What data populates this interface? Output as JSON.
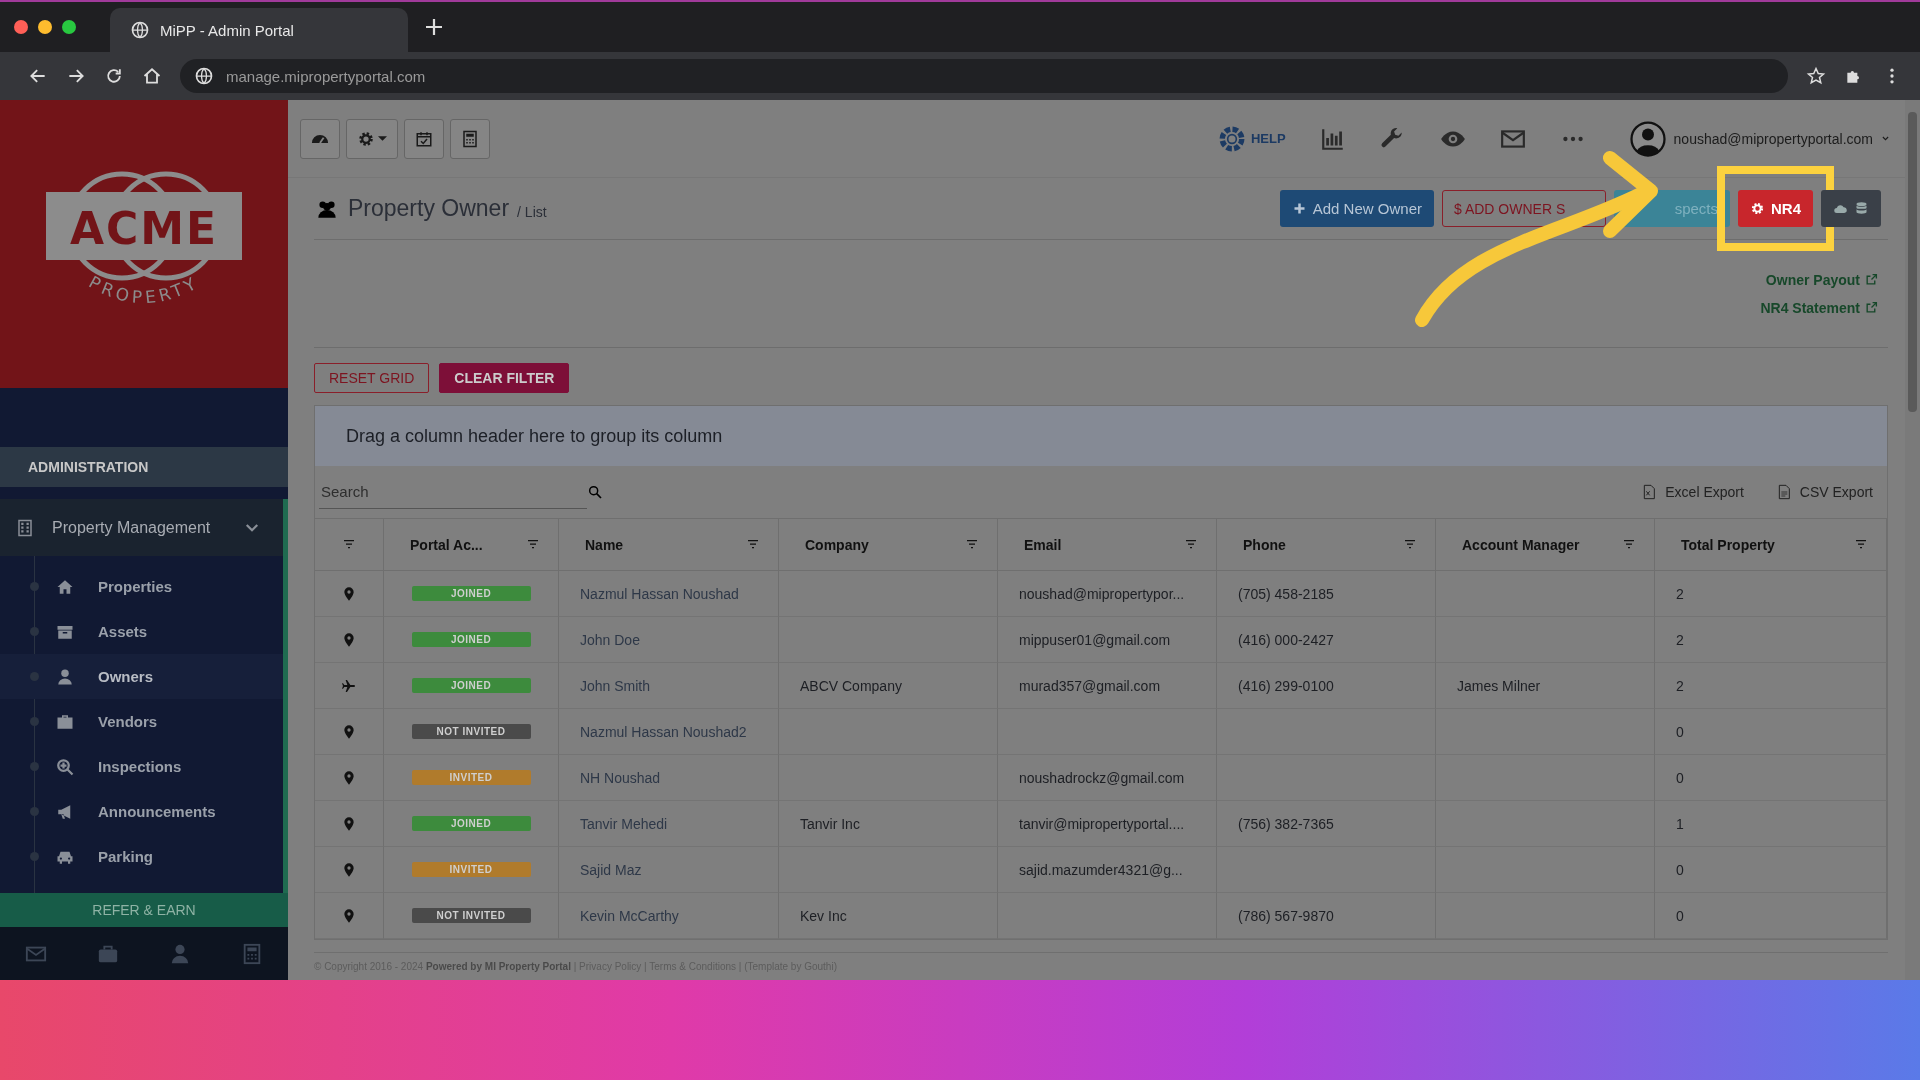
{
  "browser": {
    "tab_title": "MiPP - Admin Portal",
    "url": "manage.mipropertyportal.com"
  },
  "header": {
    "help": "HELP",
    "user_email": "noushad@mipropertyportal.com"
  },
  "sidebar": {
    "logo": {
      "wordmark": "ACME",
      "tagline": "PROPERTY"
    },
    "section": "ADMINISTRATION",
    "group": {
      "label": "Property Management",
      "expanded": true
    },
    "items": [
      {
        "label": "Properties",
        "selected": false
      },
      {
        "label": "Assets",
        "selected": false
      },
      {
        "label": "Owners",
        "selected": true
      },
      {
        "label": "Vendors",
        "selected": false
      },
      {
        "label": "Inspections",
        "selected": false
      },
      {
        "label": "Announcements",
        "selected": false
      },
      {
        "label": "Parking",
        "selected": false
      }
    ],
    "refer": "REFER & EARN"
  },
  "page": {
    "title": "Property Owner",
    "crumb": "/ List",
    "actions": [
      {
        "kind": "primary",
        "label": "Add New Owner",
        "highlighted": false
      },
      {
        "kind": "outline",
        "label": "$ ADD OWNER S",
        "highlighted": false
      },
      {
        "kind": "teal",
        "label": "spects",
        "highlighted": false
      },
      {
        "kind": "danger",
        "label": "NR4",
        "highlighted": true
      },
      {
        "kind": "dark",
        "highlighted": false
      }
    ],
    "links": [
      "Owner Payout",
      "NR4 Statement"
    ]
  },
  "grid": {
    "buttons": [
      {
        "kind": "outline",
        "label": "RESET GRID"
      },
      {
        "kind": "solid",
        "label": "CLEAR FILTER"
      }
    ],
    "group_hint": "Drag a column header here to group its column",
    "search": {
      "placeholder": "Search"
    },
    "exports": [
      {
        "kind": "excel",
        "label": "Excel Export"
      },
      {
        "kind": "csv",
        "label": "CSV Export"
      }
    ],
    "columns": [
      "Portal Ac...",
      "Name",
      "Company",
      "Email",
      "Phone",
      "Account Manager",
      "Total Property"
    ],
    "rows": [
      {
        "kind": "pin",
        "portal_access": {
          "label": "JOINED",
          "color": "#3d8b3d"
        },
        "name": "Nazmul Hassan Noushad",
        "email": "noushad@mipropertypor...",
        "phone": "(705) 458-2185",
        "total_property": "2"
      },
      {
        "kind": "pin",
        "portal_access": {
          "label": "JOINED",
          "color": "#3d8b3d"
        },
        "name": "John Doe",
        "email": "mippuser01@gmail.com",
        "phone": "(416) 000-2427",
        "total_property": "2"
      },
      {
        "kind": "plane",
        "portal_access": {
          "label": "JOINED",
          "color": "#3d8b3d"
        },
        "name": "John Smith",
        "company": "ABCV Company",
        "email": "murad357@gmail.com",
        "phone": "(416) 299-0100",
        "account_manager": "James Milner",
        "total_property": "2"
      },
      {
        "kind": "pin",
        "portal_access": {
          "label": "NOT INVITED",
          "color": "#4a4a4a"
        },
        "name": "Nazmul Hassan Noushad2",
        "total_property": "0"
      },
      {
        "kind": "pin",
        "portal_access": {
          "label": "INVITED",
          "color": "#b07b2c"
        },
        "name": "NH Noushad",
        "email": "noushadrockz@gmail.com",
        "total_property": "0"
      },
      {
        "kind": "pin",
        "portal_access": {
          "label": "JOINED",
          "color": "#3d8b3d"
        },
        "name": "Tanvir Mehedi",
        "company": "Tanvir Inc",
        "email": "tanvir@mipropertyportal....",
        "phone": "(756) 382-7365",
        "total_property": "1"
      },
      {
        "kind": "pin",
        "portal_access": {
          "label": "INVITED",
          "color": "#b07b2c"
        },
        "name": "Sajid Maz",
        "email": "sajid.mazumder4321@g...",
        "total_property": "0"
      },
      {
        "kind": "pin",
        "portal_access": {
          "label": "NOT INVITED",
          "color": "#4a4a4a"
        },
        "name": "Kevin McCarthy",
        "company": "Kev Inc",
        "phone": "(786) 567-9870",
        "total_property": "0"
      }
    ]
  },
  "footer": "© Copyright 2016 - 2024 **Powered by MI Property Portal** | Privacy Policy | Terms & Conditions | (Template by Gouthi)"
}
